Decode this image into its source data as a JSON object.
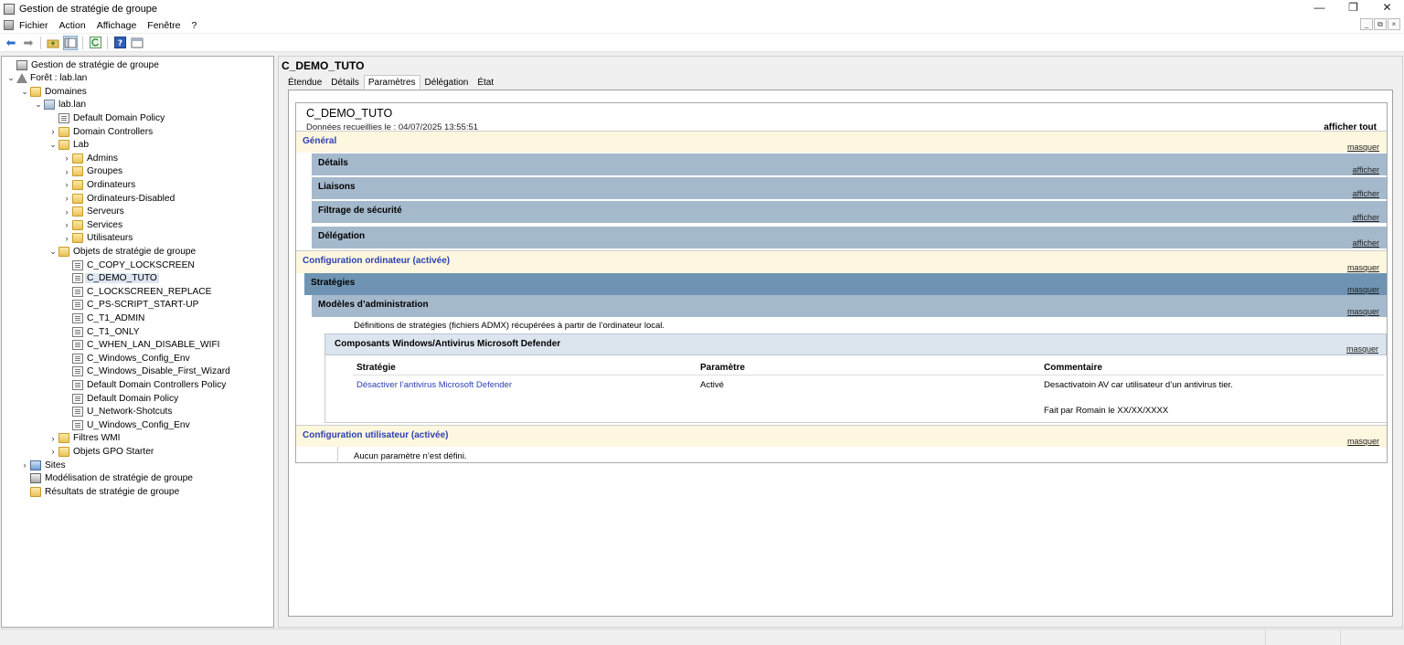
{
  "window": {
    "title": "Gestion de stratégie de groupe",
    "buttons": [
      "—",
      "❐",
      "✕"
    ]
  },
  "menu": {
    "items": [
      "Fichier",
      "Action",
      "Affichage",
      "Fenêtre",
      "?"
    ],
    "mdi_buttons": [
      "_",
      "⧉",
      "×"
    ]
  },
  "toolbar": {
    "icons": [
      "back-arrow-icon",
      "forward-arrow-icon",
      "up-folder-icon",
      "console-tree-icon",
      "refresh-icon",
      "help-icon",
      "properties-icon"
    ]
  },
  "tree": [
    {
      "label": "Gestion de stratégie de groupe",
      "level": 0,
      "chev": "",
      "icon": "root"
    },
    {
      "label": "Forêt : lab.lan",
      "level": 0,
      "chev": "v",
      "icon": "forest"
    },
    {
      "label": "Domaines",
      "level": 1,
      "chev": "v",
      "icon": "folder"
    },
    {
      "label": "lab.lan",
      "level": 2,
      "chev": "v",
      "icon": "domain"
    },
    {
      "label": "Default Domain Policy",
      "level": 3,
      "chev": "",
      "icon": "gpo"
    },
    {
      "label": "Domain Controllers",
      "level": 3,
      "chev": ">",
      "icon": "folder"
    },
    {
      "label": "Lab",
      "level": 3,
      "chev": "v",
      "icon": "folder"
    },
    {
      "label": "Admins",
      "level": 4,
      "chev": ">",
      "icon": "folder"
    },
    {
      "label": "Groupes",
      "level": 4,
      "chev": ">",
      "icon": "folder"
    },
    {
      "label": "Ordinateurs",
      "level": 4,
      "chev": ">",
      "icon": "folder"
    },
    {
      "label": "Ordinateurs-Disabled",
      "level": 4,
      "chev": ">",
      "icon": "folder"
    },
    {
      "label": "Serveurs",
      "level": 4,
      "chev": ">",
      "icon": "folder"
    },
    {
      "label": "Services",
      "level": 4,
      "chev": ">",
      "icon": "folder"
    },
    {
      "label": "Utilisateurs",
      "level": 4,
      "chev": ">",
      "icon": "folder"
    },
    {
      "label": "Objets de stratégie de groupe",
      "level": 3,
      "chev": "v",
      "icon": "folder"
    },
    {
      "label": "C_COPY_LOCKSCREEN",
      "level": 4,
      "chev": "",
      "icon": "gpo"
    },
    {
      "label": "C_DEMO_TUTO",
      "level": 4,
      "chev": "",
      "icon": "gpo",
      "selected": true
    },
    {
      "label": "C_LOCKSCREEN_REPLACE",
      "level": 4,
      "chev": "",
      "icon": "gpo"
    },
    {
      "label": "C_PS-SCRIPT_START-UP",
      "level": 4,
      "chev": "",
      "icon": "gpo"
    },
    {
      "label": "C_T1_ADMIN",
      "level": 4,
      "chev": "",
      "icon": "gpo"
    },
    {
      "label": "C_T1_ONLY",
      "level": 4,
      "chev": "",
      "icon": "gpo"
    },
    {
      "label": "C_WHEN_LAN_DISABLE_WIFI",
      "level": 4,
      "chev": "",
      "icon": "gpo"
    },
    {
      "label": "C_Windows_Config_Env",
      "level": 4,
      "chev": "",
      "icon": "gpo"
    },
    {
      "label": "C_Windows_Disable_First_Wizard",
      "level": 4,
      "chev": "",
      "icon": "gpo"
    },
    {
      "label": "Default Domain Controllers Policy",
      "level": 4,
      "chev": "",
      "icon": "gpo"
    },
    {
      "label": "Default Domain Policy",
      "level": 4,
      "chev": "",
      "icon": "gpo"
    },
    {
      "label": "U_Network-Shotcuts",
      "level": 4,
      "chev": "",
      "icon": "gpo"
    },
    {
      "label": "U_Windows_Config_Env",
      "level": 4,
      "chev": "",
      "icon": "gpo"
    },
    {
      "label": "Filtres WMI",
      "level": 3,
      "chev": ">",
      "icon": "folder"
    },
    {
      "label": "Objets GPO Starter",
      "level": 3,
      "chev": ">",
      "icon": "folder"
    },
    {
      "label": "Sites",
      "level": 1,
      "chev": ">",
      "icon": "sites"
    },
    {
      "label": "Modélisation de stratégie de groupe",
      "level": 1,
      "chev": "",
      "icon": "root"
    },
    {
      "label": "Résultats de stratégie de groupe",
      "level": 1,
      "chev": "",
      "icon": "folder"
    }
  ],
  "detail": {
    "gpo_name": "C_DEMO_TUTO",
    "tabs": [
      {
        "label": "Étendue",
        "active": false
      },
      {
        "label": "Détails",
        "active": false
      },
      {
        "label": "Paramètres",
        "active": true
      },
      {
        "label": "Délégation",
        "active": false
      },
      {
        "label": "État",
        "active": false
      }
    ]
  },
  "report": {
    "title": "C_DEMO_TUTO",
    "collected": "Données recueillies le : 04/07/2025 13:55:51",
    "show_all": "afficher tout",
    "general": {
      "title": "Général",
      "link": "masquer"
    },
    "details": {
      "title": "Détails",
      "link": "afficher"
    },
    "links": {
      "title": "Liaisons",
      "link": "afficher"
    },
    "security": {
      "title": "Filtrage de sécurité",
      "link": "afficher"
    },
    "delegation": {
      "title": "Délégation",
      "link": "afficher"
    },
    "computer": {
      "title": "Configuration ordinateur (activée)",
      "link": "masquer"
    },
    "policies": {
      "title": "Stratégies",
      "link": "masquer"
    },
    "admin_templates": {
      "title": "Modèles d’administration",
      "link": "masquer"
    },
    "admx_note": "Définitions de stratégies (fichiers ADMX) récupérées à partir de l’ordinateur local.",
    "defender": {
      "title": "Composants Windows/Antivirus Microsoft Defender",
      "link": "masquer"
    },
    "table": {
      "headers": [
        "Stratégie",
        "Paramètre",
        "Commentaire"
      ],
      "row": {
        "policy": "Désactiver l’antivirus Microsoft Defender",
        "setting": "Activé",
        "comment1": "Desactivatoin AV car utilisateur d’un antivirus tier.",
        "comment2": "Fait par Romain le XX/XX/XXXX"
      }
    },
    "user": {
      "title": "Configuration utilisateur (activée)",
      "link": "masquer"
    },
    "user_note": "Aucun paramètre n’est défini."
  },
  "colors": {
    "section_yellow": "#fef7df",
    "section_blue": "#a5b9cc",
    "section_dark": "#6f94b3",
    "link_blue": "#2a3fb5"
  }
}
